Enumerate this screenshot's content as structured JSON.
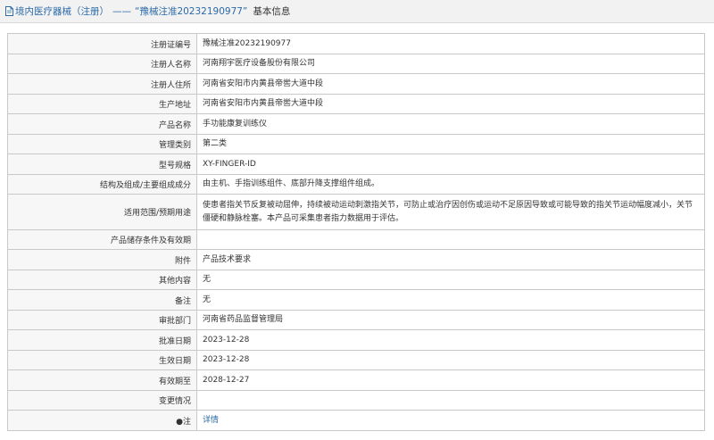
{
  "header": {
    "section": "境内医疗器械（注册）",
    "dash": "——",
    "reg_number_quoted": "“豫械注准20232190977”",
    "suffix": "基本信息"
  },
  "rows": [
    {
      "label": "注册证编号",
      "value": "豫械注准20232190977"
    },
    {
      "label": "注册人名称",
      "value": "河南翔宇医疗设备股份有限公司"
    },
    {
      "label": "注册人住所",
      "value": "河南省安阳市内黄县帝喾大道中段"
    },
    {
      "label": "生产地址",
      "value": "河南省安阳市内黄县帝喾大道中段"
    },
    {
      "label": "产品名称",
      "value": "手功能康复训练仪"
    },
    {
      "label": "管理类别",
      "value": "第二类"
    },
    {
      "label": "型号规格",
      "value": "XY-FINGER-ID"
    },
    {
      "label": "结构及组成/主要组成成分",
      "value": "由主机、手指训练组件、底部升降支撑组件组成。"
    },
    {
      "label": "适用范围/预期用途",
      "value": "使患者指关节反复被动屈伸，持续被动运动刺激指关节，可防止或治疗因创伤或运动不足原因导致或可能导致的指关节运动幅度减小，关节僵硬和静脉栓塞。本产品可采集患者指力数据用于评估。"
    },
    {
      "label": "产品储存条件及有效期",
      "value": ""
    },
    {
      "label": "附件",
      "value": "产品技术要求"
    },
    {
      "label": "其他内容",
      "value": "无"
    },
    {
      "label": "备注",
      "value": "无"
    },
    {
      "label": "审批部门",
      "value": "河南省药品监督管理局"
    },
    {
      "label": "批准日期",
      "value": "2023-12-28"
    },
    {
      "label": "生效日期",
      "value": "2023-12-28"
    },
    {
      "label": "有效期至",
      "value": "2028-12-27"
    },
    {
      "label": "变更情况",
      "value": ""
    },
    {
      "label": "●注",
      "value": "详情"
    }
  ]
}
